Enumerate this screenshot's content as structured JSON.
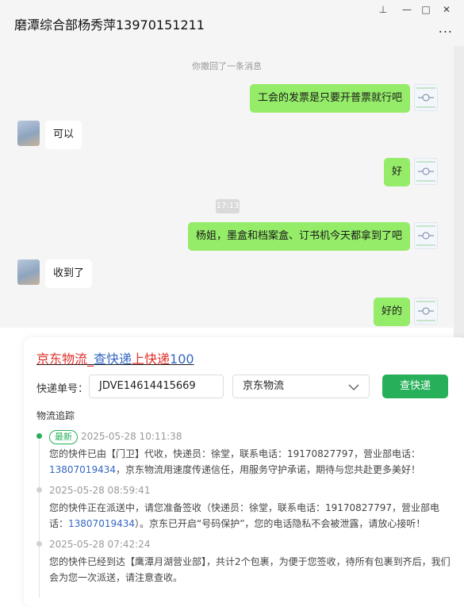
{
  "window": {
    "title": "磨潭综合部杨秀萍13970151211",
    "more_label": "...",
    "controls": {
      "pin": "⊥",
      "minimize": "—",
      "maximize": "□",
      "close": "✕"
    }
  },
  "chat": {
    "system_notice": "你撤回了一条消息",
    "time_divider": "17:13",
    "messages": [
      {
        "side": "mine",
        "text": "工会的发票是只要开普票就行吧"
      },
      {
        "side": "theirs",
        "text": "可以"
      },
      {
        "side": "mine",
        "text": "好"
      },
      {
        "side": "mine",
        "text": "杨姐，墨盒和档案盒、订书机今天都拿到了吧"
      },
      {
        "side": "theirs",
        "text": "收到了"
      },
      {
        "side": "mine",
        "text": "好的"
      }
    ]
  },
  "card": {
    "title_parts": [
      "京东物流",
      "_",
      "查快递",
      "上快递",
      "100"
    ],
    "title_colors": [
      "#e0302b",
      "#e0302b",
      "#3467c2",
      "#e0302b",
      "#3467c2"
    ],
    "tracking_label": "快递单号：",
    "tracking_value": "JDVE14614415669",
    "carrier_value": "京东物流",
    "query_button": "查快递",
    "section_title": "物流追踪",
    "accent_color": "#27b059",
    "entries": [
      {
        "badge": "最新",
        "time": "2025-05-28 10:11:38",
        "text_a": "您的快件已由【门卫】代收，快递员：徐堂，联系电话：19170827797，营业部电话：",
        "phone": "13807019434",
        "text_b": "，京东物流用速度传递信任，用服务守护承诺，期待与您共赴更多美好！"
      },
      {
        "badge": "",
        "time": "2025-05-28 08:59:41",
        "text_a": "您的快件正在派送中，请您准备签收（快递员：徐堂，联系电话：19170827797，营业部电话：",
        "phone": "13807019434",
        "text_b": "）。京东已开启“号码保护”，您的电话隐私不会被泄露，请放心接听！"
      },
      {
        "badge": "",
        "time": "2025-05-28 07:42:24",
        "text_a": "您的快件已经到达【鹰潭月湖营业部】，共计2个包裹，为便于您签收，待所有包裹到齐后，我们会为您一次派送，请注意查收。",
        "phone": "",
        "text_b": ""
      }
    ]
  }
}
